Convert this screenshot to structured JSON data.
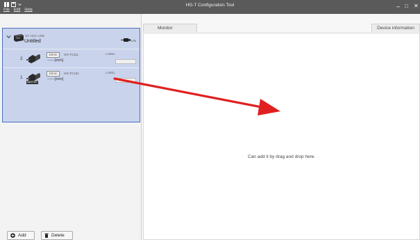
{
  "app": {
    "title": "HG-T Configuration Tool"
  },
  "menu": [
    "File",
    "Edit",
    "Help"
  ],
  "window_controls": {
    "minimize": "–",
    "maximize": "□",
    "close": "✕"
  },
  "controller": {
    "model": "SC-HG1-USB",
    "name": "Untitled",
    "connection": "USB",
    "icon": "controller-device-icon"
  },
  "sensors": [
    {
      "number": "2",
      "range": "10mm",
      "model": "HG-TC111",
      "reading": "------[mm]",
      "label_key": "LABEL",
      "label_value": "",
      "master": "",
      "icon": "sensor-head-icon"
    },
    {
      "number": "1",
      "range": "10mm",
      "model": "HG-TC101",
      "reading": "------[mm]",
      "label_key": "LABEL",
      "label_value": "",
      "master": "MASTER",
      "icon": "sensor-head-icon"
    }
  ],
  "buttons": {
    "add": "Add",
    "delete": "Delete"
  },
  "tabs": {
    "monitor": "Monitor",
    "device_info": "Device information"
  },
  "drop_message": "Can add it by drag and drop here.",
  "colors": {
    "selection_bg": "#c9d3ec",
    "selection_border": "#4a6ec2",
    "arrow": "#e02020",
    "titlebar": "#5a5a5a"
  }
}
